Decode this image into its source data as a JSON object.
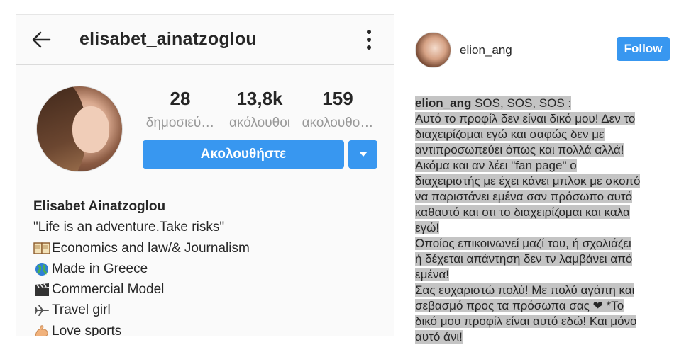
{
  "profile_header": {
    "username": "elisabet_ainatzoglou"
  },
  "stats": [
    {
      "value": "28",
      "label": "δημοσιεύ…"
    },
    {
      "value": "13,8k",
      "label": "ακόλουθοι"
    },
    {
      "value": "159",
      "label": "ακολουθο…"
    }
  ],
  "follow_button_label": "Ακολουθήστε",
  "bio": {
    "name": "Elisabet Ainatzoglou",
    "lines": [
      "\"Life is an adventure.Take risks\"",
      "Economics and law/& Journalism",
      "Made in Greece",
      "Commercial Model",
      "Travel girl",
      "Love sports"
    ]
  },
  "post": {
    "author": "elion_ang",
    "follow_label": "Follow",
    "caption_author": "elion_ang",
    "caption_lines": [
      "SOS, SOS, SOS :",
      "Αυτό το προφίλ δεν είναι δικό μου! Δεν το",
      "διαχειρίζομαι εγώ και σαφώς δεν με",
      "αντιπροσωπεύει όπως και πολλά αλλά!",
      "Ακόμα και αν λέει \"fan page\" ο",
      "διαχειριστής με έχει κάνει μπλοκ με σκοπό",
      "να παριστάνει εμένα σαν πρόσωπο αυτό",
      "καθαυτό και οτι το διαχειρίζομαι και καλα",
      "εγώ!",
      "Οποίος επικοινωνεί μαζί του, ή σχολιάζει",
      "ή δέχεται απάντηση δεν τν λαμβάνει από",
      "εμένα!",
      "Σας ευχαριστώ πολύ! Με πολύ αγάπη και",
      "σεβασμό προς τα πρόσωπα σας ❤ *Το",
      "δικό μου προφίλ είναι αυτό εδώ! Και μόνο",
      "αυτό άνι!"
    ]
  },
  "colors": {
    "accent": "#3897f0",
    "highlight": "#c4c4c4"
  }
}
